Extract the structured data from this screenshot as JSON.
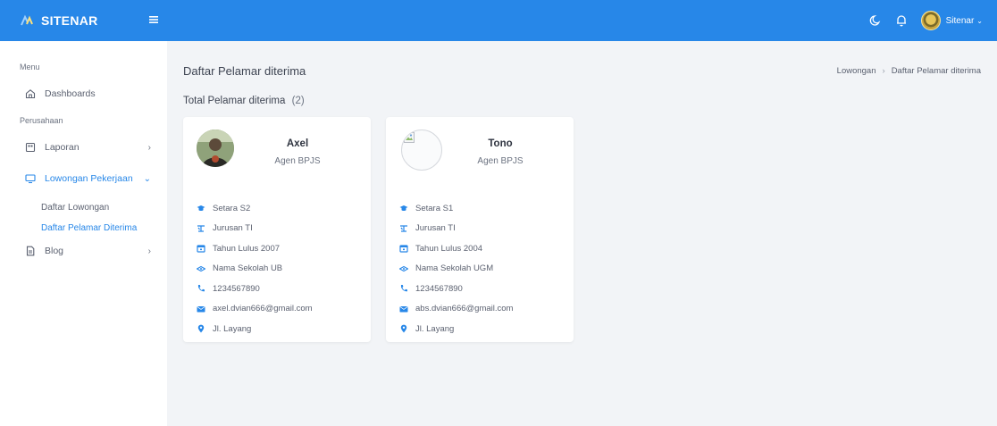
{
  "app": {
    "name": "SITENAR"
  },
  "header": {
    "user_name": "Sitenar"
  },
  "sidebar": {
    "section_menu": "Menu",
    "dashboards": "Dashboards",
    "section_company": "Perusahaan",
    "laporan": "Laporan",
    "lowongan": "Lowongan Pekerjaan",
    "sub_daftar_lowongan": "Daftar Lowongan",
    "sub_daftar_pelamar": "Daftar Pelamar Diterima",
    "blog": "Blog"
  },
  "page": {
    "title": "Daftar Pelamar diterima",
    "breadcrumb": [
      "Lowongan",
      "Daftar Pelamar diterima"
    ],
    "total_label": "Total Pelamar diterima",
    "total_count": "(2)"
  },
  "applicants": [
    {
      "name": "Axel",
      "role": "Agen BPJS",
      "degree": "Setara S2",
      "major": "Jurusan TI",
      "graduation": "Tahun Lulus 2007",
      "school": "Nama Sekolah UB",
      "phone": "1234567890",
      "email": "axel.dvian666@gmail.com",
      "address": "Jl. Layang"
    },
    {
      "name": "Tono",
      "role": "Agen BPJS",
      "degree": "Setara S1",
      "major": "Jurusan TI",
      "graduation": "Tahun Lulus 2004",
      "school": "Nama Sekolah UGM",
      "phone": "1234567890",
      "email": "abs.dvian666@gmail.com",
      "address": "Jl. Layang"
    }
  ],
  "colors": {
    "primary": "#2787e8",
    "background": "#f2f4f7",
    "card": "#ffffff"
  },
  "icons": {
    "degree": "graduation-cap-icon",
    "major": "network-icon",
    "graduation": "calendar-icon",
    "school": "school-icon",
    "phone": "phone-icon",
    "email": "envelope-icon",
    "address": "map-pin-icon"
  }
}
